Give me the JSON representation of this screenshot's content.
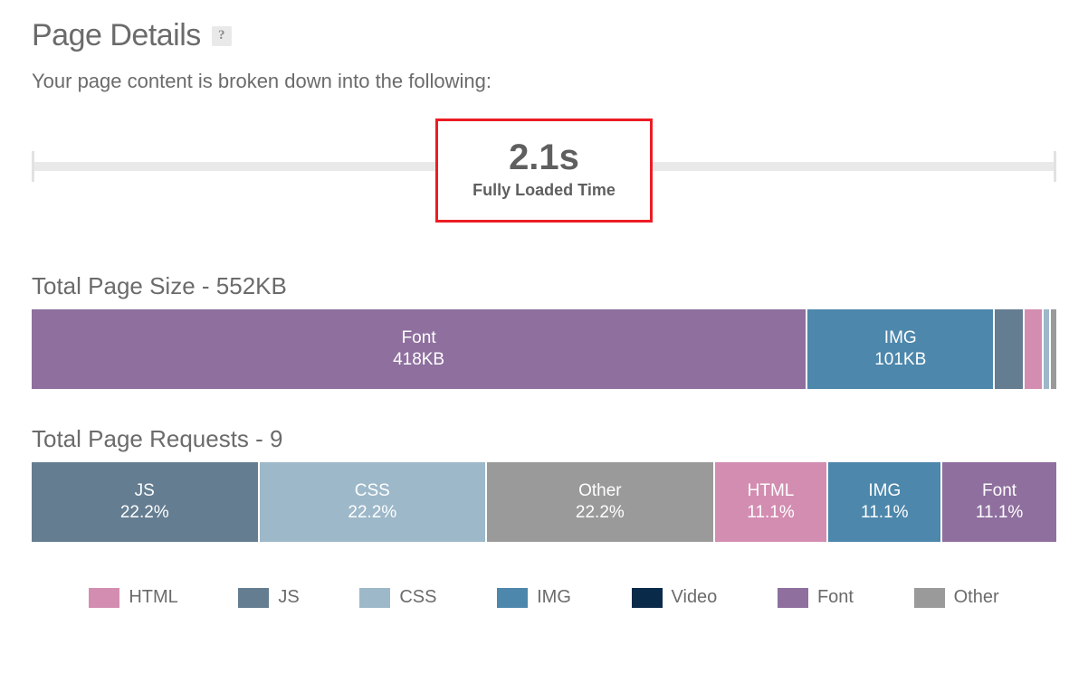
{
  "header": {
    "title": "Page Details",
    "help_symbol": "?",
    "intro": "Your page content is broken down into the following:"
  },
  "load": {
    "value": "2.1s",
    "label": "Fully Loaded Time"
  },
  "size_section": {
    "title": "Total Page Size - 552KB"
  },
  "requests_section": {
    "title": "Total Page Requests - 9"
  },
  "colors": {
    "HTML": "#d38db1",
    "JS": "#647d91",
    "CSS": "#9db8c9",
    "IMG": "#4d87ac",
    "Video": "#0a2a4a",
    "Font": "#8e6f9e",
    "Other": "#9a9a9a"
  },
  "legend_order": [
    "HTML",
    "JS",
    "CSS",
    "IMG",
    "Video",
    "Font",
    "Other"
  ],
  "chart_data": [
    {
      "type": "bar",
      "title": "Total Page Size - 552KB",
      "unit": "KB",
      "total": 552,
      "series": [
        {
          "name": "Font",
          "value": 418,
          "label": "418KB",
          "show_label": true
        },
        {
          "name": "IMG",
          "value": 101,
          "label": "101KB",
          "show_label": true
        },
        {
          "name": "JS",
          "value": 16,
          "label": "",
          "show_label": false
        },
        {
          "name": "HTML",
          "value": 10,
          "label": "",
          "show_label": false
        },
        {
          "name": "CSS",
          "value": 4,
          "label": "",
          "show_label": false
        },
        {
          "name": "Other",
          "value": 3,
          "label": "",
          "show_label": false
        }
      ]
    },
    {
      "type": "bar",
      "title": "Total Page Requests - 9",
      "unit": "%",
      "total": 100,
      "series": [
        {
          "name": "JS",
          "value": 22.2,
          "label": "22.2%",
          "show_label": true
        },
        {
          "name": "CSS",
          "value": 22.2,
          "label": "22.2%",
          "show_label": true
        },
        {
          "name": "Other",
          "value": 22.2,
          "label": "22.2%",
          "show_label": true
        },
        {
          "name": "HTML",
          "value": 11.1,
          "label": "11.1%",
          "show_label": true
        },
        {
          "name": "IMG",
          "value": 11.1,
          "label": "11.1%",
          "show_label": true
        },
        {
          "name": "Font",
          "value": 11.1,
          "label": "11.1%",
          "show_label": true
        }
      ]
    }
  ]
}
